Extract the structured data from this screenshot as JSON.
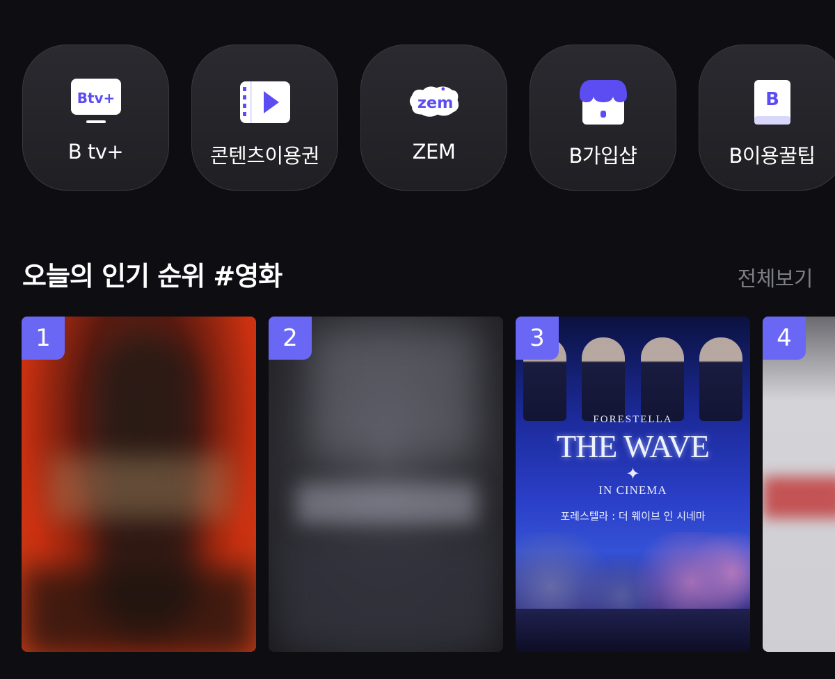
{
  "quick_menu": {
    "items": [
      {
        "label": "B tv+",
        "icon": "btv-plus-icon",
        "icon_text": "Btv+"
      },
      {
        "label": "콘텐츠이용권",
        "icon": "film-play-icon"
      },
      {
        "label": "ZEM",
        "icon": "zem-icon",
        "icon_text": "zem"
      },
      {
        "label": "B가입샵",
        "icon": "store-icon"
      },
      {
        "label": "B이용꿀팁",
        "icon": "book-icon",
        "icon_text": "B"
      }
    ]
  },
  "ranking": {
    "title": "오늘의 인기 순위 #영화",
    "view_all": "전체보기",
    "cards": [
      {
        "rank": "1"
      },
      {
        "rank": "2"
      },
      {
        "rank": "3",
        "poster_brand": "FORESTELLA",
        "poster_title": "THE WAVE",
        "poster_subtitle": "IN CINEMA",
        "poster_korean": "포레스텔라 : 더 웨이브 인 시네마"
      },
      {
        "rank": "4"
      }
    ]
  },
  "colors": {
    "background": "#0d0d12",
    "accent": "#6a67f4",
    "icon_purple": "#5b4df2",
    "muted_text": "#7d7d85"
  }
}
